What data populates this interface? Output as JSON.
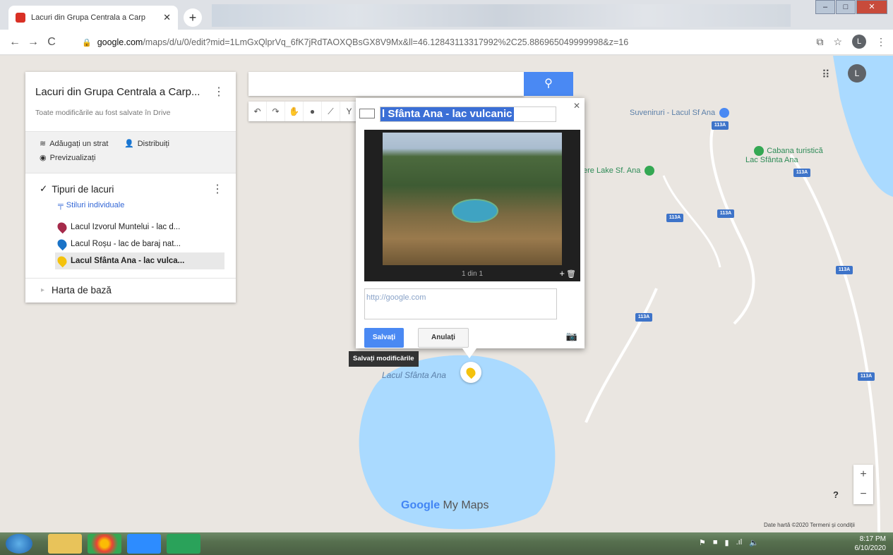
{
  "browser": {
    "tab_title": "Lacuri din Grupa Centrala a Carp",
    "tab_close": "✕",
    "new_tab": "+",
    "url_host": "google.com",
    "url_path": "/maps/d/u/0/edit?mid=1LmGxQlprVq_6fK7jRdTAOXQBsGX8V9Mx&ll=46.12843113317992%2C25.886965049999998&z=16",
    "avatar_letter": "L"
  },
  "panel": {
    "title": "Lacuri din Grupa Centrala a Carp...",
    "subtitle": "Toate modificările au fost salvate în Drive",
    "add_layer": "Adăugați un strat",
    "share": "Distribuiți",
    "preview": "Previzualizați",
    "layer_name": "Tipuri de lacuri",
    "styles_link": "Stiluri individuale",
    "places": [
      {
        "label": "Lacul Izvorul Muntelui - lac d...",
        "color": "#a52a4a"
      },
      {
        "label": "Lacul Roșu - lac de baraj nat...",
        "color": "#1a73c7"
      },
      {
        "label": "Lacul Sfânta Ana - lac vulca...",
        "color": "#f4c20d"
      }
    ],
    "base_map": "Harta de bază"
  },
  "infowindow": {
    "title": "l Sfânta Ana - lac vulcanic",
    "photo_count": "1 din 1",
    "description_placeholder": "http://google.com",
    "save": "Salvați",
    "cancel": "Anulați",
    "tooltip": "Salvați modificările"
  },
  "map": {
    "labels": {
      "souvenirs": "Suveniruri - Lacul Sf Ana",
      "cabana": "Cabana turistică\nLac Sfânta Ana",
      "lake_sf_ana": "ere Lake Sf. Ana",
      "lake_pin": "Lacul Sfânta Ana"
    },
    "road_number": "113A",
    "logo_google": "Google",
    "logo_mymaps": " My Maps",
    "attribution": "Date hartă ©2020   Termeni și condiții",
    "zoom_in": "+",
    "zoom_out": "−",
    "help": "?",
    "user_avatar": "L"
  },
  "taskbar": {
    "time": "8:17 PM",
    "date": "6/10/2020"
  }
}
